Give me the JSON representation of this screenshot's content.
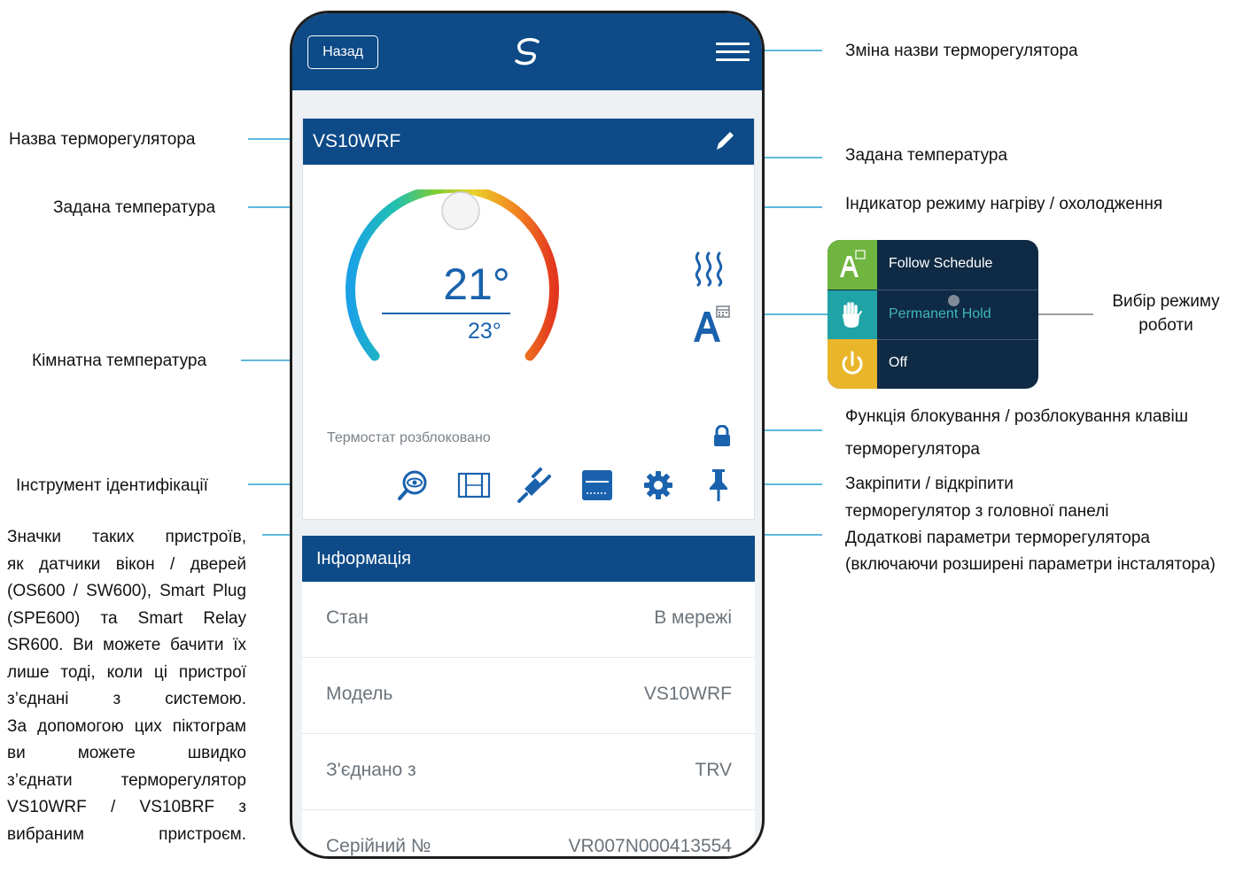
{
  "app": {
    "back_label": "Назад",
    "menu": "hamburger-menu-icon",
    "logo": "brand-swirl-logo",
    "colors": {
      "primary": "#0d4a87",
      "temp_text": "#1a62ad",
      "follow_schedule": "#6fb53f",
      "permanent_hold": "#20a3a6",
      "off": "#e9b52a"
    }
  },
  "thermostat": {
    "name": "VS10WRF",
    "set_temperature": "21°",
    "room_temperature": "23°",
    "status": "Термостат розблоковано",
    "heating_icon": "heat-waves-icon",
    "mode_icon": "auto-schedule-icon",
    "lock_icon": "lock-icon",
    "toolbar_icons": [
      "identify-icon",
      "window-sensor-icon",
      "smart-plug-icon",
      "relay-icon",
      "settings-icon",
      "pin-icon"
    ]
  },
  "info": {
    "title": "Інформація",
    "rows": [
      {
        "key": "Стан",
        "value": "В мережі"
      },
      {
        "key": "Модель",
        "value": "VS10WRF"
      },
      {
        "key": "З'єднано з",
        "value": "TRV"
      },
      {
        "key": "Серійний №",
        "value": "VR007N000413554"
      }
    ]
  },
  "modes": [
    {
      "label": "Follow Schedule",
      "icon": "auto-schedule-icon"
    },
    {
      "label": "Permanent Hold",
      "icon": "hand-icon"
    },
    {
      "label": "Off",
      "icon": "power-icon"
    }
  ],
  "annotations": {
    "rename": "Зміна назви терморегулятора",
    "name": "Назва терморегулятора",
    "set_temp_left": "Задана температура",
    "set_temp_right": "Задана температура",
    "heat_cool": "Індикатор режиму нагріву / охолодження",
    "mode_select_1": "Вибір режиму",
    "mode_select_2": "роботи",
    "room_temp": "Кімнатна температура",
    "lock_1": "Функція блокування / розблокування клавіш",
    "lock_2": "терморегулятора",
    "identify": "Інструмент ідентифікації",
    "pin_1": "Закріпити / відкріпити",
    "pin_2": "терморегулятор з головної панелі",
    "settings_1": "Додаткові параметри терморегулятора",
    "settings_2": "(включаючи розширені параметри інсталятора)",
    "devices_lines": [
      "Значки таких пристроїв,",
      "як датчики вікон / дверей",
      "(OS600 / SW600), Smart Plug",
      "(SPE600) та Smart Relay",
      "SR600. Ви можете бачити їх",
      "лише тоді, коли ці пристрої",
      "з’єднані з системою.",
      "За допомогою цих піктограм",
      "ви можете швидко",
      "з’єднати терморегулятор",
      "VS10WRF / VS10BRF з",
      "вибраним пристроєм."
    ]
  }
}
